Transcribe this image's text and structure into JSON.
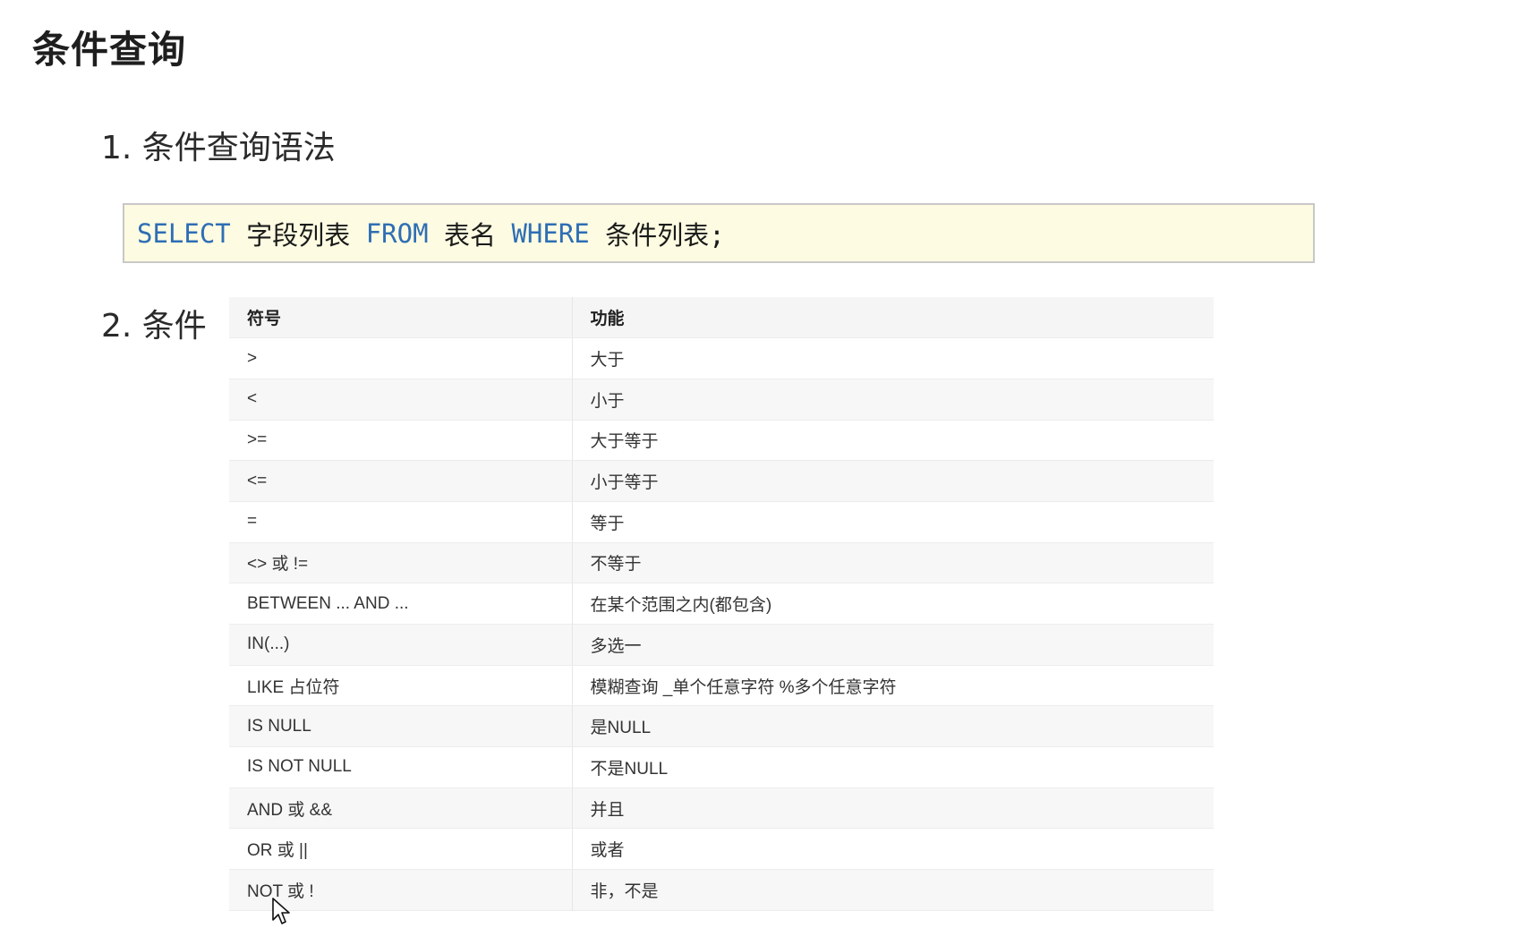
{
  "page": {
    "title": "条件查询"
  },
  "sections": [
    {
      "heading": "1. 条件查询语法"
    },
    {
      "heading": "2. 条件"
    }
  ],
  "code": {
    "tokens": [
      {
        "text": "SELECT",
        "kind": "keyword"
      },
      {
        "text": " 字段列表 ",
        "kind": "text"
      },
      {
        "text": "FROM",
        "kind": "keyword"
      },
      {
        "text": " 表名 ",
        "kind": "text"
      },
      {
        "text": "WHERE",
        "kind": "keyword"
      },
      {
        "text": " 条件列表;",
        "kind": "text"
      }
    ],
    "background_color": "#fdfbe1",
    "keyword_color": "#2e6eb5"
  },
  "table": {
    "headers": [
      "符号",
      "功能"
    ],
    "rows": [
      [
        ">",
        "大于"
      ],
      [
        "<",
        "小于"
      ],
      [
        ">=",
        "大于等于"
      ],
      [
        "<=",
        "小于等于"
      ],
      [
        "=",
        "等于"
      ],
      [
        "<> 或 !=",
        "不等于"
      ],
      [
        "BETWEEN ... AND ...",
        "在某个范围之内(都包含)"
      ],
      [
        "IN(...)",
        "多选一"
      ],
      [
        "LIKE 占位符",
        "模糊查询 _单个任意字符 %多个任意字符"
      ],
      [
        "IS NULL",
        "是NULL"
      ],
      [
        "IS NOT NULL",
        "不是NULL"
      ],
      [
        "AND 或 &&",
        "并且"
      ],
      [
        "OR 或 ||",
        "或者"
      ],
      [
        "NOT 或 !",
        "非，不是"
      ]
    ]
  },
  "icons": {
    "cursor": "mouse-pointer-icon"
  }
}
